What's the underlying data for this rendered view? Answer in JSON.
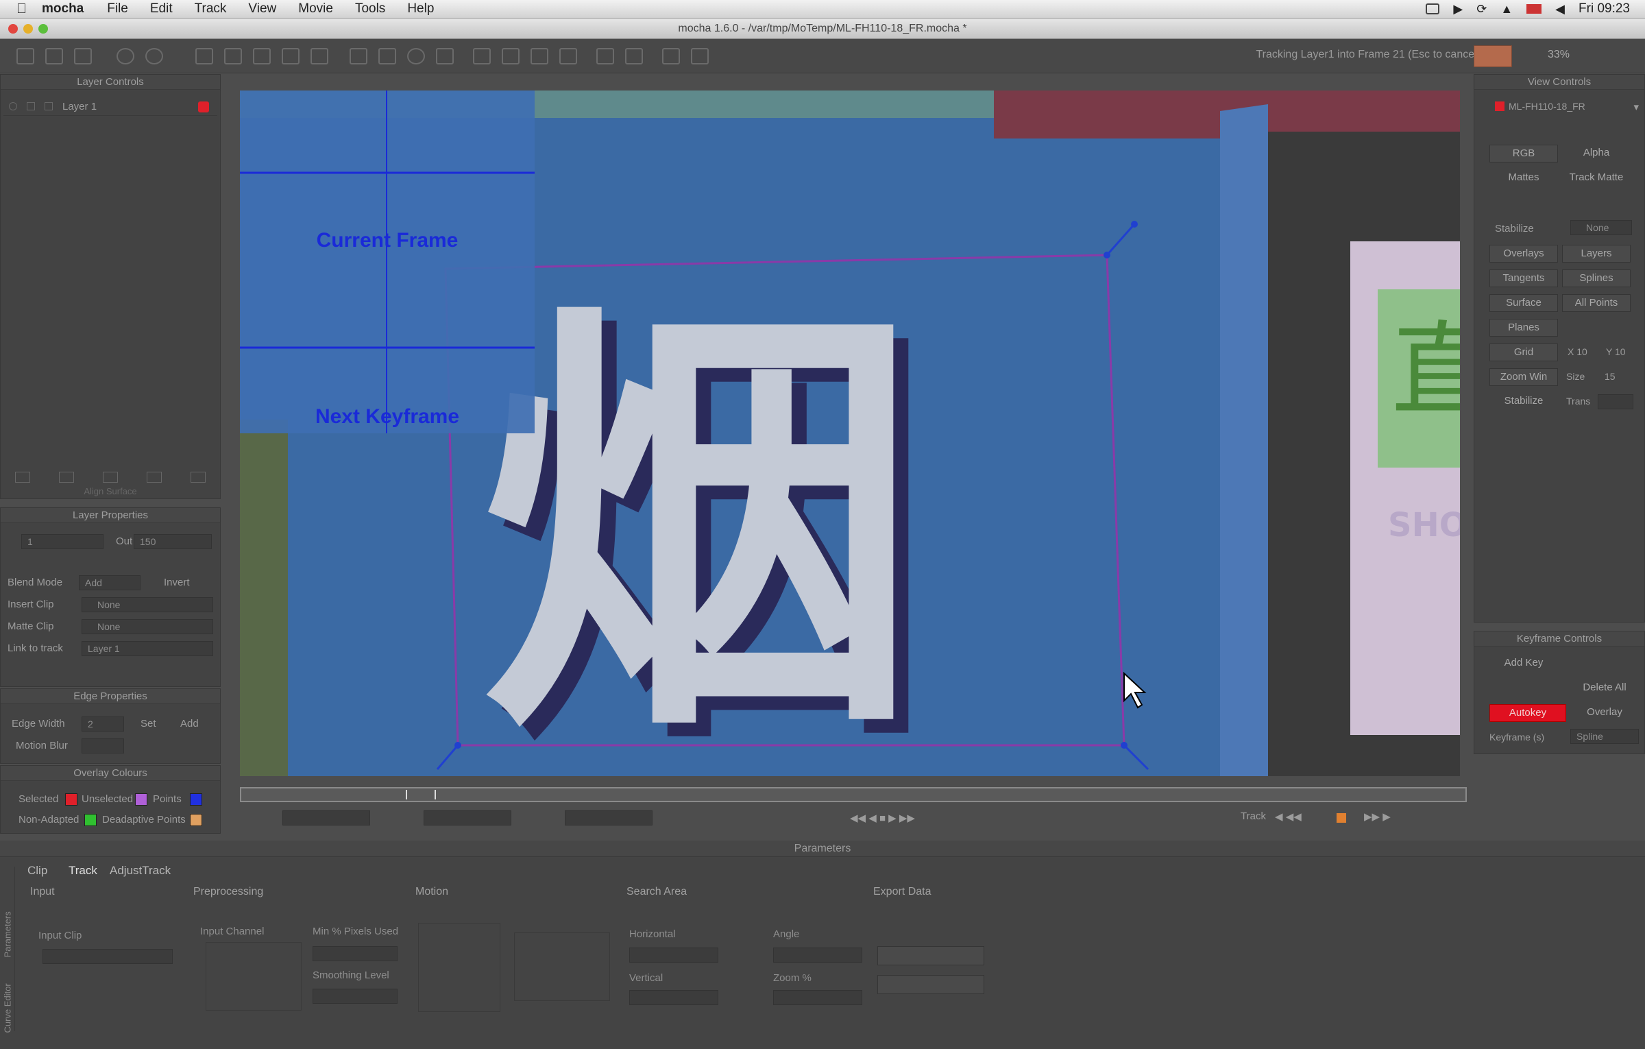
{
  "menubar": {
    "app_name": "mocha",
    "items": [
      "File",
      "Edit",
      "Track",
      "View",
      "Movie",
      "Tools",
      "Help"
    ],
    "clock": "Fri 09:23"
  },
  "window": {
    "title": "mocha 1.6.0 - /var/tmp/MoTemp/ML-FH110-18_FR.mocha *"
  },
  "toolbar": {
    "status_text": "Tracking Layer1 into Frame 21 (Esc to cancel)",
    "zoom_level": "33%"
  },
  "layer_controls": {
    "title": "Layer Controls",
    "layers": [
      {
        "name": "Layer 1",
        "color": "#e0202a"
      }
    ],
    "footer_label": "Align Surface"
  },
  "layer_properties": {
    "title": "Layer Properties",
    "in_value": "1",
    "out_label": "Out",
    "out_value": "150",
    "blend_mode_label": "Blend Mode",
    "blend_mode_value": "Add",
    "invert_label": "Invert",
    "insert_clip_label": "Insert Clip",
    "insert_clip_value": "None",
    "matte_clip_label": "Matte Clip",
    "matte_clip_value": "None",
    "link_to_track_label": "Link to track",
    "link_to_track_value": "Layer 1"
  },
  "edge_properties": {
    "title": "Edge Properties",
    "edge_width_label": "Edge Width",
    "edge_width_value": "2",
    "set_label": "Set",
    "add_label": "Add",
    "motion_blur_label": "Motion Blur"
  },
  "overlay_colours": {
    "title": "Overlay Colours",
    "selected_label": "Selected",
    "selected_color": "#e0202a",
    "unselected_label": "Unselected",
    "unselected_color": "#b060d8",
    "points_label": "Points",
    "points_color": "#2030e0",
    "non_adapted_label": "Non-Adapted",
    "non_adapted_color": "#30c030",
    "deadaptive_label": "Deadaptive Points",
    "deadaptive_color": "#e0a060"
  },
  "viewer": {
    "overlay_current_frame": "Current Frame",
    "overlay_next_keyframe": "Next Keyframe"
  },
  "view_controls": {
    "title": "View Controls",
    "clip_name": "ML-FH110-18_FR",
    "rgb": "RGB",
    "alpha": "Alpha",
    "mattes": "Mattes",
    "track_matte": "Track Matte",
    "stabilize_label": "Stabilize",
    "stabilize_value": "None",
    "overlays": "Overlays",
    "layers": "Layers",
    "tangents": "Tangents",
    "splines": "Splines",
    "surface": "Surface",
    "all_points": "All Points",
    "planes": "Planes",
    "grid_label": "Grid",
    "grid_x": "X 10",
    "grid_y": "Y 10",
    "zoom_win_label": "Zoom Win",
    "size_label": "Size",
    "size_value": "15",
    "stabilize_btn": "Stabilize",
    "trans_label": "Trans"
  },
  "keyframe_controls": {
    "title": "Keyframe Controls",
    "add_key": "Add Key",
    "delete_all": "Delete All",
    "autokey": "Autokey",
    "autokey_color": "#e01020",
    "overlay": "Overlay",
    "keyframe_label": "Keyframe (s)",
    "spline_value": "Spline"
  },
  "transport": {
    "track_label": "Track"
  },
  "parameters": {
    "title": "Parameters",
    "tabs": [
      "Clip",
      "Track",
      "AdjustTrack"
    ],
    "side_tabs": [
      "Parameters",
      "Curve Editor"
    ],
    "sections": [
      "Input",
      "Preprocessing",
      "Motion",
      "Search Area",
      "Export Data"
    ],
    "input_clip_label": "Input Clip",
    "input_channel_label": "Input Channel",
    "min_pixels_label": "Min % Pixels Used",
    "smoothing_label": "Smoothing Level",
    "horizontal_label": "Horizontal",
    "vertical_label": "Vertical",
    "angle_label": "Angle",
    "zoom_label": "Zoom %"
  }
}
